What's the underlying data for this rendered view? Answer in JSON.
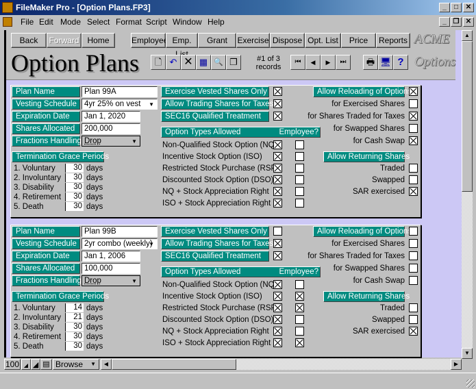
{
  "window": {
    "title": "FileMaker Pro - [Option Plans.FP3]",
    "controls": {
      "minimize": "_",
      "maximize": "□",
      "close": "✕",
      "restore": "❐"
    }
  },
  "menubar": {
    "items": [
      "File",
      "Edit",
      "Mode",
      "Select",
      "Format",
      "Script",
      "Window",
      "Help"
    ]
  },
  "nav": {
    "buttons": [
      {
        "label": "Back",
        "enabled": true
      },
      {
        "label": "Forward",
        "enabled": false
      },
      {
        "label": "Home",
        "enabled": true
      },
      {
        "label": "Employee",
        "enabled": true
      },
      {
        "label": "Emp. List",
        "enabled": true
      },
      {
        "label": "Grant",
        "enabled": true
      },
      {
        "label": "Exercise",
        "enabled": true
      },
      {
        "label": "Dispose",
        "enabled": true
      },
      {
        "label": "Opt. List",
        "enabled": true
      },
      {
        "label": "Price",
        "enabled": true
      },
      {
        "label": "Reports",
        "enabled": true
      }
    ],
    "brand": "ACME"
  },
  "header": {
    "page_title": "Option Plans",
    "tools": [
      {
        "name": "new-record-icon",
        "glyph": "🗋"
      },
      {
        "name": "undo-icon",
        "glyph": "↶"
      },
      {
        "name": "delete-icon",
        "glyph": "✕"
      },
      {
        "name": "table-view-icon",
        "glyph": "▦"
      },
      {
        "name": "find-icon",
        "glyph": "🔍"
      },
      {
        "name": "duplicate-icon",
        "glyph": "❐"
      }
    ],
    "record_count_line1": "#1 of 3",
    "record_count_line2": "records",
    "record_nav": [
      {
        "name": "first-record-icon",
        "glyph": "⏮"
      },
      {
        "name": "prev-record-icon",
        "glyph": "◀"
      },
      {
        "name": "next-record-icon",
        "glyph": "▶"
      },
      {
        "name": "last-record-icon",
        "glyph": "⏭"
      }
    ],
    "util": [
      {
        "name": "print-icon",
        "glyph": "🖶"
      },
      {
        "name": "computer-icon",
        "glyph": "🖥"
      },
      {
        "name": "help-icon",
        "glyph": "?"
      }
    ],
    "subtitle": "Options"
  },
  "labels": {
    "plan_name": "Plan Name",
    "vesting_schedule": "Vesting Schedule",
    "expiration_date": "Expiration Date",
    "shares_allocated": "Shares Allocated",
    "fractions_handling": "Fractions Handling",
    "termination_grace_periods": "Termination Grace Periods",
    "days": "days",
    "grace_items": [
      "1. Voluntary",
      "2. Involuntary",
      "3. Disability",
      "4. Retirement",
      "5. Death"
    ],
    "exercise_vested_only": "Exercise Vested Shares Only",
    "allow_trading_taxes": "Allow Trading Shares for Taxes",
    "sec16": "SEC16 Qualified Treatment",
    "option_types_allowed": "Option Types Allowed",
    "employee_q": "Employee?",
    "option_types": [
      "Non-Qualified Stock Option (NQ)",
      "Incentive Stock Option (ISO)",
      "Restricted Stock Purchase (RSP)",
      "Discounted Stock Option (DSO)",
      "NQ + Stock Appreciation Right",
      "ISO + Stock Appreciation Right"
    ],
    "allow_reloading": "Allow Reloading of Options",
    "reload_items": [
      "for Exercised Shares",
      "for Shares Traded for Taxes",
      "for Swapped Shares",
      "for Cash Swap"
    ],
    "allow_returning": "Allow Returning Shares",
    "return_items": [
      "Traded",
      "Swapped",
      "SAR exercised"
    ]
  },
  "records": [
    {
      "plan_name": "Plan 99A",
      "vesting_schedule": "4yr 25% on vest",
      "expiration_date": "Jan 1, 2020",
      "shares_allocated": "200,000",
      "fractions_handling": "Drop",
      "grace_days": [
        "30",
        "30",
        "30",
        "30",
        "30"
      ],
      "exercise_vested_only": true,
      "allow_trading_taxes": true,
      "sec16": true,
      "option_allowed": [
        true,
        true,
        true,
        true,
        true,
        true
      ],
      "option_employee": [
        false,
        false,
        false,
        false,
        false,
        false
      ],
      "allow_reloading": true,
      "reload": [
        false,
        true,
        false,
        true
      ],
      "returning": [
        false,
        false,
        true
      ]
    },
    {
      "plan_name": "Plan 99B",
      "vesting_schedule": "2yr combo (weekly)",
      "expiration_date": "Jan 1, 2006",
      "shares_allocated": "100,000",
      "fractions_handling": "Drop",
      "grace_days": [
        "14",
        "21",
        "30",
        "30",
        "30"
      ],
      "exercise_vested_only": false,
      "allow_trading_taxes": true,
      "sec16": true,
      "option_allowed": [
        true,
        true,
        true,
        true,
        true,
        true
      ],
      "option_employee": [
        false,
        true,
        true,
        false,
        false,
        true
      ],
      "allow_reloading": false,
      "reload": [
        false,
        false,
        false,
        false
      ],
      "returning": [
        false,
        false,
        true
      ]
    }
  ],
  "bottombar": {
    "zoom_level": "100",
    "mode": "Browse"
  },
  "scroll": {
    "vertical_thumb_start_fraction": 0.0,
    "vertical_thumb_size_fraction": 0.49
  }
}
